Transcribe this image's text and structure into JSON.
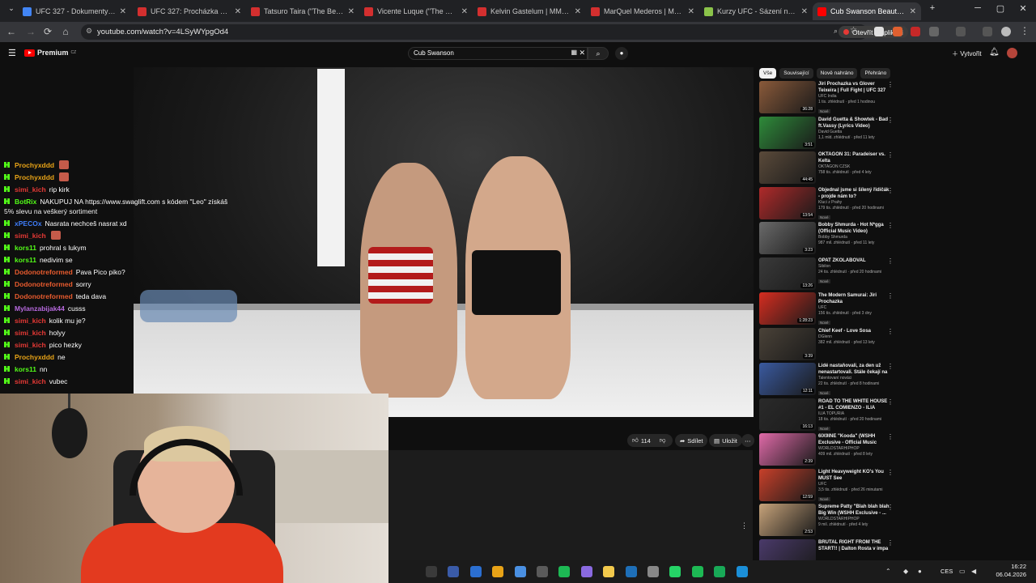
{
  "browser": {
    "tabs": [
      {
        "title": "UFC 327 - Dokumenty Goog",
        "color": "#4285f4",
        "active": false
      },
      {
        "title": "UFC 327: Procházka vs. Ulbe",
        "color": "#d32f2f",
        "active": false
      },
      {
        "title": "Tatsuro Taira (\"The Best\") | M",
        "color": "#d32f2f",
        "active": false
      },
      {
        "title": "Vicente Luque (\"The Silent A",
        "color": "#d32f2f",
        "active": false
      },
      {
        "title": "Kelvin Gastelum | MMA Figh",
        "color": "#d32f2f",
        "active": false
      },
      {
        "title": "MarQuel Mederos | MMA Fi",
        "color": "#d32f2f",
        "active": false
      },
      {
        "title": "Kurzy UFC - Sázení na Bojov",
        "color": "#8bc34a",
        "active": false
      },
      {
        "title": "Cub Swanson Beautiful Deat",
        "color": "#ff0000",
        "active": true
      }
    ],
    "new_tab": "+",
    "url": "youtube.com/watch?v=4LSyWYpgOd4",
    "open_in_app": "Otevřít v aplikaci",
    "minimize": "─",
    "maximize": "▢",
    "close": "✕"
  },
  "youtube": {
    "logo": "Premium",
    "logo_superscript": "CZ",
    "search_value": "Cub Swanson",
    "create_label": "Vytvořit",
    "actions": {
      "likes": "114",
      "share": "Sdílet",
      "save": "Uložit",
      "more": "⋯"
    },
    "chips": [
      {
        "label": "Vše",
        "selected": true
      },
      {
        "label": "Související",
        "selected": false
      },
      {
        "label": "Nově nahráno",
        "selected": false
      },
      {
        "label": "Přehráno",
        "selected": false
      }
    ],
    "recommendations": [
      {
        "title": "Jiri Prochazka vs Glover Teixeira | Full Fight | UFC 327",
        "channel": "UFC India",
        "meta": "1 tis. zhlédnutí · před 1 hodinou",
        "badge": "Nové",
        "duration": "36:28",
        "thumb": "#8a5a3a"
      },
      {
        "title": "David Guetta & Showtek - Bad ft.Vassy (Lyrics Video)",
        "channel": "David Guetta",
        "meta": "1,1 mld. zhlédnutí · před 11 lety",
        "badge": "",
        "duration": "3:51",
        "thumb": "#2e8b3a"
      },
      {
        "title": "OKTAGON 31: Paradeiser vs. Kelta",
        "channel": "OKTAGON CZSK",
        "meta": "758 tis. zhlédnutí · před 4 lety",
        "badge": "",
        "duration": "44:45",
        "thumb": "#5a4a3a"
      },
      {
        "title": "Objednal jsme si šílený řidičák - projde nám to?",
        "channel": "Kluci z Prahy",
        "meta": "179 tis. zhlédnutí · před 20 hodinami",
        "badge": "Nové",
        "duration": "13:54",
        "thumb": "#b02a2a"
      },
      {
        "title": "Bobby Shmurda - Hot N*gga (Official Music Video)",
        "channel": "Bobby Shmurda",
        "meta": "987 mil. zhlédnutí · před 11 lety",
        "badge": "",
        "duration": "3:23",
        "thumb": "#6a6a6a"
      },
      {
        "title": "OPAT ZKOLABOVAL",
        "channel": "Sibilon",
        "meta": "24 tis. zhlédnutí · před 20 hodinami",
        "badge": "Nové",
        "duration": "13:26",
        "thumb": "#3a3a3a"
      },
      {
        "title": "The Modern Samurai: Jiri Prochazka",
        "channel": "UFC",
        "meta": "156 tis. zhlédnutí · před 3 dny",
        "badge": "Nové",
        "duration": "1:28:23",
        "thumb": "#d62d20"
      },
      {
        "title": "Chief Keef - Love Sosa",
        "channel": "DGlenn",
        "meta": "382 mil. zhlédnutí · před 13 lety",
        "badge": "",
        "duration": "3:39",
        "thumb": "#4a4238"
      },
      {
        "title": "Lidé nastaňovali, za den už nenastartovali. Stále čekají na ...",
        "channel": "Talentovaní nováci",
        "meta": "22 tis. zhlédnutí · před 8 hodinami",
        "badge": "Nové",
        "duration": "12:11",
        "thumb": "#3a5aa0"
      },
      {
        "title": "ROAD TO THE WHITE HOUSE #1 - EL COMIENZO - ILIA TOPURIA",
        "channel": "ILIA TOPURIA",
        "meta": "18 tis. zhlédnutí · před 20 hodinami",
        "badge": "Nové",
        "duration": "16:13",
        "thumb": "#2a2a2a"
      },
      {
        "title": "6IX9INE \"Kooda\" (WSHH Exclusive - Official Music Video)",
        "channel": "WORLDSTARHIPHOP",
        "meta": "409 mil. zhlédnutí · před 8 lety",
        "badge": "",
        "duration": "2:39",
        "thumb": "#e06aa8"
      },
      {
        "title": "Light Heavyweight KO's You MUST See",
        "channel": "UFC",
        "meta": "3,5 tis. zhlédnutí · před 26 minutami",
        "badge": "Nové",
        "duration": "12:59",
        "thumb": "#c8402a"
      },
      {
        "title": "Supreme Patty \"Blah blah blah Big Win (WSHH Exclusive - ...",
        "channel": "WORLDSTARHIPHOP",
        "meta": "9 mil. zhlédnutí · před 4 lety",
        "badge": "",
        "duration": "2:53",
        "thumb": "#c7a37a"
      },
      {
        "title": "BRUTAL RIGHT FROM THE START!! | Dalton Rosta v impa ...",
        "channel": "",
        "meta": "",
        "badge": "",
        "duration": "",
        "thumb": "#4a3a6a"
      }
    ]
  },
  "chat": [
    {
      "user": "Prochyxddd",
      "color": "#e8a317",
      "text": "",
      "emote": true
    },
    {
      "user": "Prochyxddd",
      "color": "#e8a317",
      "text": "",
      "emote": true
    },
    {
      "user": "simi_kich",
      "color": "#e53935",
      "text": "rip kirk",
      "emote": false
    },
    {
      "user": "BotRix",
      "color": "#53fc18",
      "text": "NAKUPUJ NA https://www.swaglift.com s kódem \"Leo\" získáš",
      "emote": false,
      "cont": "5% slevu na veškerý sortiment"
    },
    {
      "user": "xPECOx",
      "color": "#3f7dfa",
      "text": "Nasrata nechceš nasrat xd",
      "emote": false
    },
    {
      "user": "simi_kich",
      "color": "#e53935",
      "text": "",
      "emote": true
    },
    {
      "user": "kors11",
      "color": "#53fc18",
      "text": "prohral s lukym",
      "emote": false
    },
    {
      "user": "kors11",
      "color": "#53fc18",
      "text": "nedivim se",
      "emote": false
    },
    {
      "user": "Dodonotreformed",
      "color": "#e85b2e",
      "text": "Pava Pico piko?",
      "emote": false
    },
    {
      "user": "Dodonotreformed",
      "color": "#e85b2e",
      "text": "sorry",
      "emote": false
    },
    {
      "user": "Dodonotreformed",
      "color": "#e85b2e",
      "text": "teda dava",
      "emote": false
    },
    {
      "user": "Mylanzabijak44",
      "color": "#b86ae0",
      "text": "cusss",
      "emote": false
    },
    {
      "user": "simi_kich",
      "color": "#e53935",
      "text": "kolik mu je?",
      "emote": false
    },
    {
      "user": "simi_kich",
      "color": "#e53935",
      "text": "holyy",
      "emote": false
    },
    {
      "user": "simi_kich",
      "color": "#e53935",
      "text": "pico hezky",
      "emote": false
    },
    {
      "user": "Prochyxddd",
      "color": "#e8a317",
      "text": "ne",
      "emote": false
    },
    {
      "user": "kors11",
      "color": "#53fc18",
      "text": "nn",
      "emote": false
    },
    {
      "user": "simi_kich",
      "color": "#e53935",
      "text": "vubec",
      "emote": false
    }
  ],
  "taskbar": {
    "language": "CES",
    "time": "16:22",
    "date": "06.04.2026",
    "apps": [
      "#2d2d2d",
      "#3a5ba8",
      "#2b6fd1",
      "#e8a317",
      "#4a90e2",
      "#5a5a5a",
      "#1db954",
      "#8a6ae0",
      "#f2c94c",
      "#1e6fb8",
      "#888",
      "#25d366",
      "#1db954",
      "#18a957",
      "#1b8fd8"
    ]
  }
}
